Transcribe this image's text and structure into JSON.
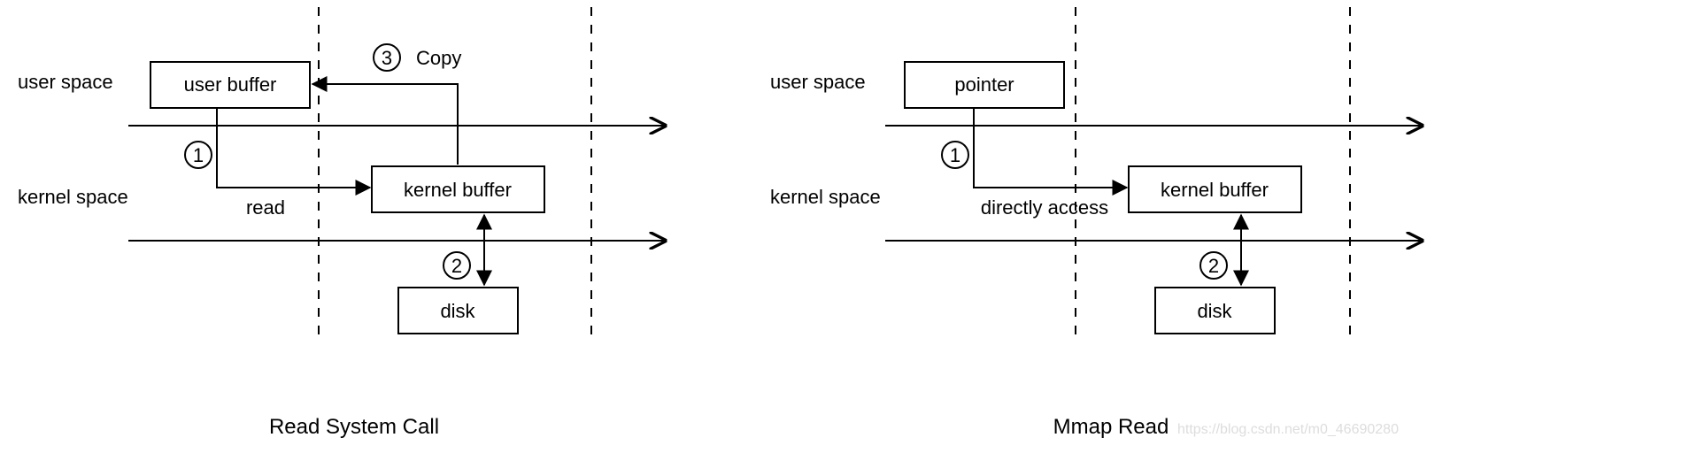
{
  "left": {
    "caption": "Read System Call",
    "user_space": "user space",
    "kernel_space": "kernel space",
    "user_buffer": "user buffer",
    "kernel_buffer": "kernel buffer",
    "disk": "disk",
    "step1_num": "1",
    "step1_label": "read",
    "step2_num": "2",
    "step3_num": "3",
    "step3_label": "Copy"
  },
  "right": {
    "caption": "Mmap Read",
    "user_space": "user space",
    "kernel_space": "kernel space",
    "pointer": "pointer",
    "kernel_buffer": "kernel buffer",
    "disk": "disk",
    "step1_num": "1",
    "step1_label": "directly access",
    "step2_num": "2"
  },
  "watermark": "https://blog.csdn.net/m0_46690280"
}
